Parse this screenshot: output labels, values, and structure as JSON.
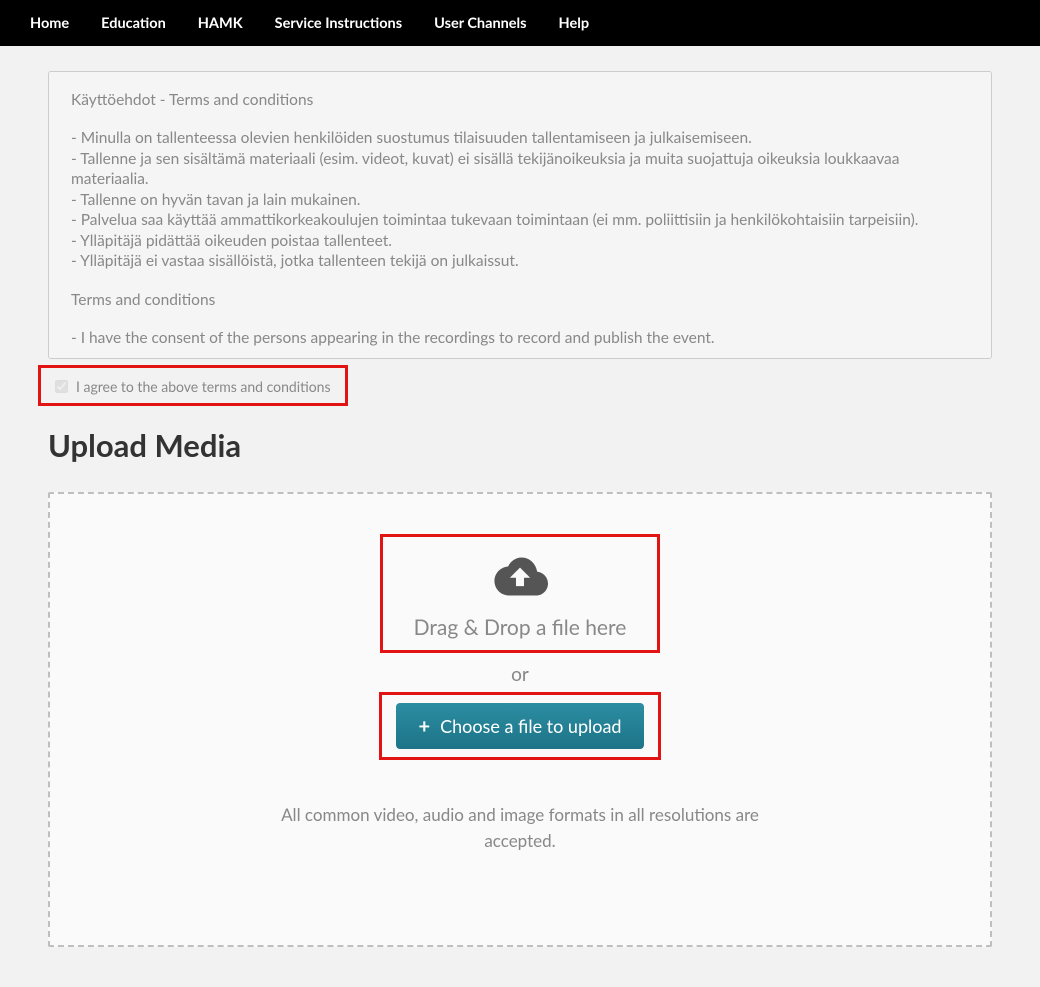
{
  "nav": {
    "items": [
      "Home",
      "Education",
      "HAMK",
      "Service Instructions",
      "User Channels",
      "Help"
    ]
  },
  "terms": {
    "heading": "Käyttöehdot - Terms and conditions",
    "fi_lines": [
      "- Minulla on tallenteessa olevien henkilöiden suostumus tilaisuuden tallentamiseen ja julkaisemiseen.",
      "- Tallenne ja sen sisältämä materiaali (esim. videot, kuvat) ei sisällä tekijänoikeuksia ja muita suojattuja oikeuksia loukkaavaa materiaalia.",
      "- Tallenne on hyvän tavan ja lain mukainen.",
      "- Palvelua saa käyttää ammattikorkeakoulujen toimintaa tukevaan toimintaan (ei mm. poliittisiin ja henkilökohtaisiin tarpeisiin).",
      "- Ylläpitäjä pidättää oikeuden poistaa tallenteet.",
      "- Ylläpitäjä ei vastaa sisällöistä, jotka tallenteen tekijä on julkaissut."
    ],
    "en_heading": "Terms and conditions",
    "en_lines": [
      "- I have the consent of the persons appearing in the recordings to record and publish the event."
    ]
  },
  "agree": {
    "label": "I agree to the above terms and conditions",
    "checked": true
  },
  "upload": {
    "heading": "Upload Media",
    "drag_label": "Drag & Drop a file here",
    "or_label": "or",
    "choose_label": "Choose a file to upload",
    "formats_note": "All common video, audio and image formats in all resolutions are accepted."
  },
  "colors": {
    "highlight": "#e11313",
    "button": "#1f7f94"
  }
}
